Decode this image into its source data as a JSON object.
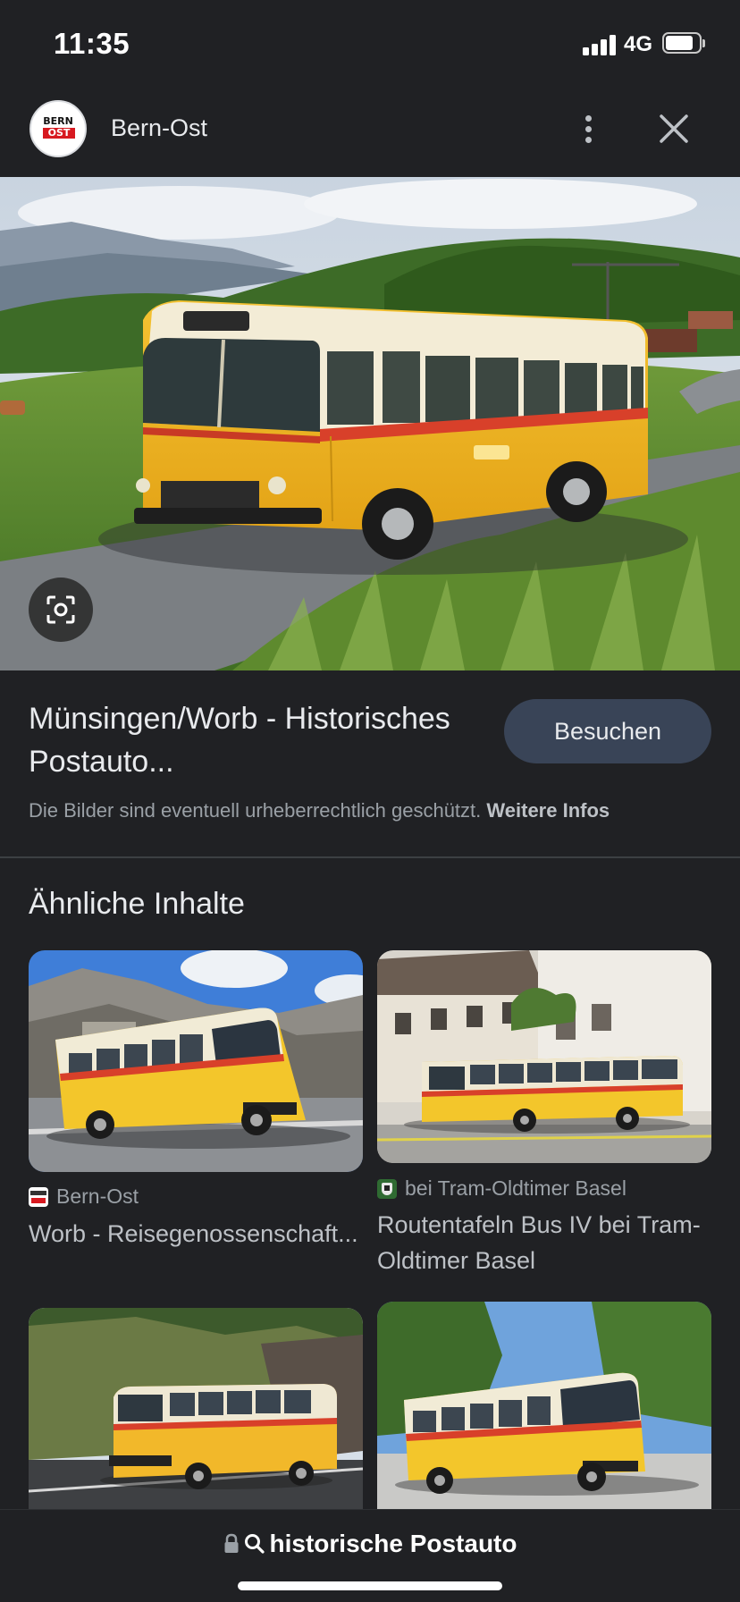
{
  "status_bar": {
    "time": "11:35",
    "network": "4G"
  },
  "source": {
    "logo_line1": "BERN",
    "logo_line2": "OST",
    "name": "Bern-Ost",
    "icons": [
      "more-vert-icon",
      "close-icon"
    ]
  },
  "result": {
    "title": "Münsingen/Worb - Historisches Postauto...",
    "visit_label": "Besuchen",
    "copyright_text": "Die Bilder sind eventuell urheberrechtlich geschützt.",
    "more_info_label": "Weitere Infos"
  },
  "related": {
    "heading": "Ähnliche Inhalte",
    "items": [
      {
        "source": "Bern-Ost",
        "title": "Worb - Reisegenossenschaft..."
      },
      {
        "source": "bei Tram-Oldtimer Basel",
        "title": "Routentafeln Bus IV bei Tram-Oldtimer Basel"
      }
    ]
  },
  "search": {
    "query": "historische Postauto"
  },
  "colors": {
    "background": "#202124",
    "visit_button": "#394457",
    "postbus_yellow": "#f2b82a",
    "postbus_red": "#d8402a"
  }
}
